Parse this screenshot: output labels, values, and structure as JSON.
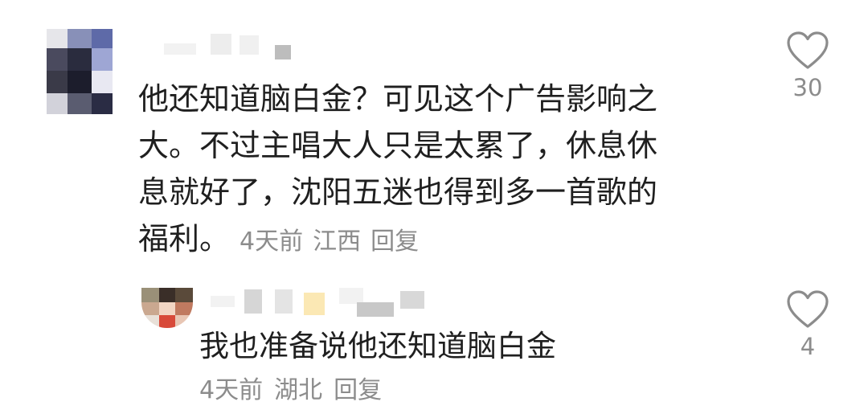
{
  "comments": [
    {
      "text_lines": [
        "他还知道脑白金？可见这个广告影响之",
        "大。不过主唱大人只是太累了，休息休",
        "息就好了，沈阳五迷也得到多一首歌的",
        "福利。"
      ],
      "time": "4天前",
      "location": "江西",
      "reply_label": "回复",
      "like_count": "30",
      "like_icon": "heart-outline-icon"
    },
    {
      "text": "我也准备说他还知道脑白金",
      "time": "4天前",
      "location": "湖北",
      "reply_label": "回复",
      "like_count": "4",
      "like_icon": "heart-outline-icon"
    }
  ],
  "colors": {
    "text": "#1f1f1f",
    "meta": "#8c8c8c",
    "background": "#ffffff"
  }
}
